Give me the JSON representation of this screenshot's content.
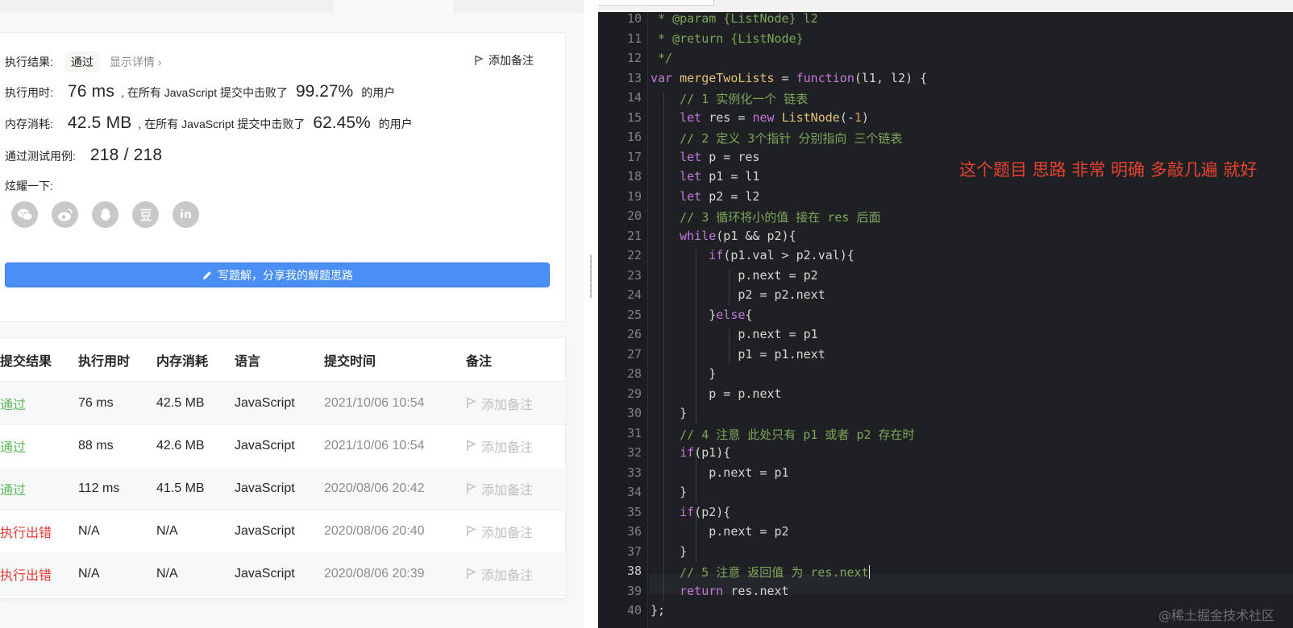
{
  "result": {
    "status_label": "执行结果:",
    "status_value": "通过",
    "details_link": "显示详情 ›",
    "add_note": "添加备注",
    "runtime_label": "执行用时:",
    "runtime_value": "76 ms",
    "runtime_text": ", 在所有 JavaScript 提交中击败了",
    "runtime_pct": "99.27%",
    "runtime_suffix": "的用户",
    "memory_label": "内存消耗:",
    "memory_value": "42.5 MB",
    "memory_text": ", 在所有 JavaScript 提交中击败了",
    "memory_pct": "62.45%",
    "memory_suffix": "的用户",
    "tests_label": "通过测试用例:",
    "tests_value": "218 / 218",
    "share_label": "炫耀一下:",
    "share_icons": [
      "wechat-icon",
      "weibo-icon",
      "qq-icon",
      "douban-icon",
      "linkedin-icon"
    ],
    "write_button": "写题解，分享我的解题思路"
  },
  "submissions": {
    "headers": [
      "提交结果",
      "执行用时",
      "内存消耗",
      "语言",
      "提交时间",
      "备注"
    ],
    "rows": [
      {
        "result": "通过",
        "ok": true,
        "time": "76 ms",
        "mem": "42.5 MB",
        "lang": "JavaScript",
        "when": "2021/10/06 10:54",
        "note": "添加备注"
      },
      {
        "result": "通过",
        "ok": true,
        "time": "88 ms",
        "mem": "42.6 MB",
        "lang": "JavaScript",
        "when": "2021/10/06 10:54",
        "note": "添加备注"
      },
      {
        "result": "通过",
        "ok": true,
        "time": "112 ms",
        "mem": "41.5 MB",
        "lang": "JavaScript",
        "when": "2020/08/06 20:42",
        "note": "添加备注"
      },
      {
        "result": "执行出错",
        "ok": false,
        "time": "N/A",
        "mem": "N/A",
        "lang": "JavaScript",
        "when": "2020/08/06 20:40",
        "note": "添加备注"
      },
      {
        "result": "执行出错",
        "ok": false,
        "time": "N/A",
        "mem": "N/A",
        "lang": "JavaScript",
        "when": "2020/08/06 20:39",
        "note": "添加备注"
      }
    ]
  },
  "editor": {
    "first_line_number": 10,
    "current_line": 38,
    "lines": [
      " * @param {ListNode} l2",
      " * @return {ListNode}",
      " */",
      "var mergeTwoLists = function(l1, l2) {",
      "    // 1 实例化一个 链表",
      "    let res = new ListNode(-1)",
      "    // 2 定义 3个指针 分别指向 三个链表",
      "    let p = res",
      "    let p1 = l1",
      "    let p2 = l2",
      "    // 3 循环将小的值 接在 res 后面",
      "    while(p1 && p2){",
      "        if(p1.val > p2.val){",
      "            p.next = p2",
      "            p2 = p2.next",
      "        }else{",
      "            p.next = p1",
      "            p1 = p1.next",
      "        }",
      "        p = p.next",
      "    }",
      "    // 4 注意 此处只有 p1 或者 p2 存在时",
      "    if(p1){",
      "        p.next = p1",
      "    }",
      "    if(p2){",
      "        p.next = p2",
      "    }",
      "    // 5 注意 返回值 为 res.next",
      "    return res.next",
      "};"
    ],
    "annotation": "这个题目 思路 非常 明确 多敲几遍 就好",
    "watermark": "@稀土掘金技术社区"
  }
}
